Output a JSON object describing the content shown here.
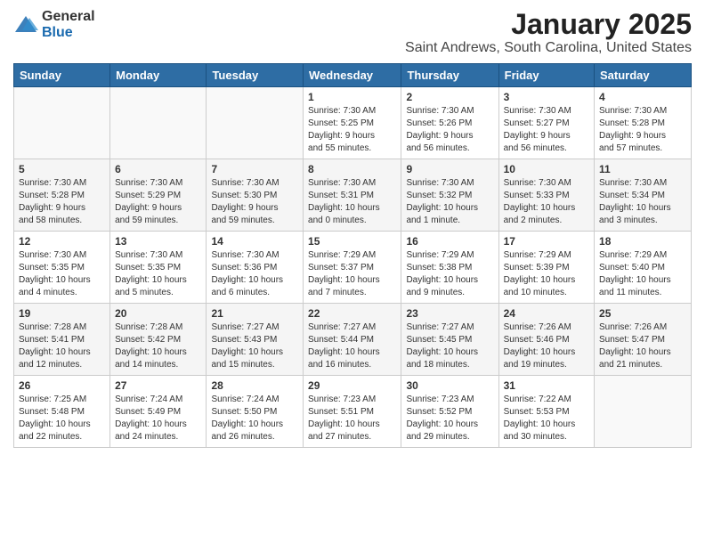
{
  "header": {
    "logo_general": "General",
    "logo_blue": "Blue",
    "main_title": "January 2025",
    "sub_title": "Saint Andrews, South Carolina, United States"
  },
  "weekdays": [
    "Sunday",
    "Monday",
    "Tuesday",
    "Wednesday",
    "Thursday",
    "Friday",
    "Saturday"
  ],
  "weeks": [
    [
      {
        "day": "",
        "info": ""
      },
      {
        "day": "",
        "info": ""
      },
      {
        "day": "",
        "info": ""
      },
      {
        "day": "1",
        "info": "Sunrise: 7:30 AM\nSunset: 5:25 PM\nDaylight: 9 hours\nand 55 minutes."
      },
      {
        "day": "2",
        "info": "Sunrise: 7:30 AM\nSunset: 5:26 PM\nDaylight: 9 hours\nand 56 minutes."
      },
      {
        "day": "3",
        "info": "Sunrise: 7:30 AM\nSunset: 5:27 PM\nDaylight: 9 hours\nand 56 minutes."
      },
      {
        "day": "4",
        "info": "Sunrise: 7:30 AM\nSunset: 5:28 PM\nDaylight: 9 hours\nand 57 minutes."
      }
    ],
    [
      {
        "day": "5",
        "info": "Sunrise: 7:30 AM\nSunset: 5:28 PM\nDaylight: 9 hours\nand 58 minutes."
      },
      {
        "day": "6",
        "info": "Sunrise: 7:30 AM\nSunset: 5:29 PM\nDaylight: 9 hours\nand 59 minutes."
      },
      {
        "day": "7",
        "info": "Sunrise: 7:30 AM\nSunset: 5:30 PM\nDaylight: 9 hours\nand 59 minutes."
      },
      {
        "day": "8",
        "info": "Sunrise: 7:30 AM\nSunset: 5:31 PM\nDaylight: 10 hours\nand 0 minutes."
      },
      {
        "day": "9",
        "info": "Sunrise: 7:30 AM\nSunset: 5:32 PM\nDaylight: 10 hours\nand 1 minute."
      },
      {
        "day": "10",
        "info": "Sunrise: 7:30 AM\nSunset: 5:33 PM\nDaylight: 10 hours\nand 2 minutes."
      },
      {
        "day": "11",
        "info": "Sunrise: 7:30 AM\nSunset: 5:34 PM\nDaylight: 10 hours\nand 3 minutes."
      }
    ],
    [
      {
        "day": "12",
        "info": "Sunrise: 7:30 AM\nSunset: 5:35 PM\nDaylight: 10 hours\nand 4 minutes."
      },
      {
        "day": "13",
        "info": "Sunrise: 7:30 AM\nSunset: 5:35 PM\nDaylight: 10 hours\nand 5 minutes."
      },
      {
        "day": "14",
        "info": "Sunrise: 7:30 AM\nSunset: 5:36 PM\nDaylight: 10 hours\nand 6 minutes."
      },
      {
        "day": "15",
        "info": "Sunrise: 7:29 AM\nSunset: 5:37 PM\nDaylight: 10 hours\nand 7 minutes."
      },
      {
        "day": "16",
        "info": "Sunrise: 7:29 AM\nSunset: 5:38 PM\nDaylight: 10 hours\nand 9 minutes."
      },
      {
        "day": "17",
        "info": "Sunrise: 7:29 AM\nSunset: 5:39 PM\nDaylight: 10 hours\nand 10 minutes."
      },
      {
        "day": "18",
        "info": "Sunrise: 7:29 AM\nSunset: 5:40 PM\nDaylight: 10 hours\nand 11 minutes."
      }
    ],
    [
      {
        "day": "19",
        "info": "Sunrise: 7:28 AM\nSunset: 5:41 PM\nDaylight: 10 hours\nand 12 minutes."
      },
      {
        "day": "20",
        "info": "Sunrise: 7:28 AM\nSunset: 5:42 PM\nDaylight: 10 hours\nand 14 minutes."
      },
      {
        "day": "21",
        "info": "Sunrise: 7:27 AM\nSunset: 5:43 PM\nDaylight: 10 hours\nand 15 minutes."
      },
      {
        "day": "22",
        "info": "Sunrise: 7:27 AM\nSunset: 5:44 PM\nDaylight: 10 hours\nand 16 minutes."
      },
      {
        "day": "23",
        "info": "Sunrise: 7:27 AM\nSunset: 5:45 PM\nDaylight: 10 hours\nand 18 minutes."
      },
      {
        "day": "24",
        "info": "Sunrise: 7:26 AM\nSunset: 5:46 PM\nDaylight: 10 hours\nand 19 minutes."
      },
      {
        "day": "25",
        "info": "Sunrise: 7:26 AM\nSunset: 5:47 PM\nDaylight: 10 hours\nand 21 minutes."
      }
    ],
    [
      {
        "day": "26",
        "info": "Sunrise: 7:25 AM\nSunset: 5:48 PM\nDaylight: 10 hours\nand 22 minutes."
      },
      {
        "day": "27",
        "info": "Sunrise: 7:24 AM\nSunset: 5:49 PM\nDaylight: 10 hours\nand 24 minutes."
      },
      {
        "day": "28",
        "info": "Sunrise: 7:24 AM\nSunset: 5:50 PM\nDaylight: 10 hours\nand 26 minutes."
      },
      {
        "day": "29",
        "info": "Sunrise: 7:23 AM\nSunset: 5:51 PM\nDaylight: 10 hours\nand 27 minutes."
      },
      {
        "day": "30",
        "info": "Sunrise: 7:23 AM\nSunset: 5:52 PM\nDaylight: 10 hours\nand 29 minutes."
      },
      {
        "day": "31",
        "info": "Sunrise: 7:22 AM\nSunset: 5:53 PM\nDaylight: 10 hours\nand 30 minutes."
      },
      {
        "day": "",
        "info": ""
      }
    ]
  ]
}
